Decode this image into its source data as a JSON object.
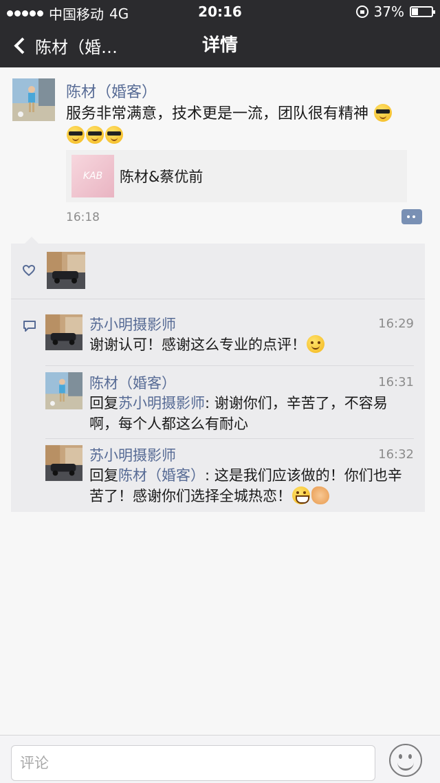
{
  "status_bar": {
    "carrier": "中国移动",
    "network": "4G",
    "time": "20:16",
    "battery": "37%"
  },
  "nav": {
    "back_label": "陈材（婚…",
    "title": "详情"
  },
  "post": {
    "author": "陈材（婚客）",
    "text": "服务非常满意，技术更是一流，团队很有精神",
    "link_card": {
      "title": "陈材&蔡优前",
      "thumb_text": "KAB"
    },
    "time": "16:18"
  },
  "comments": [
    {
      "author": "苏小明摄影师",
      "time": "16:29",
      "text": "谢谢认可！感谢这么专业的点评！"
    },
    {
      "author": "陈材（婚客）",
      "time": "16:31",
      "reply_prefix": "回复",
      "reply_to": "苏小明摄影师",
      "reply_colon": ":",
      "text": "谢谢你们，辛苦了，不容易啊，每个人都这么有耐心"
    },
    {
      "author": "苏小明摄影师",
      "time": "16:32",
      "reply_prefix": "回复",
      "reply_to": "陈材（婚客）",
      "reply_colon": ":",
      "text": "这是我们应该做的！你们也辛苦了！感谢你们选择全城热恋！"
    }
  ],
  "input": {
    "placeholder": "评论"
  },
  "colors": {
    "bar_bg": "#2b2b2e",
    "link_blue": "#576b95",
    "page_bg": "#f7f7f7"
  },
  "icons": [
    "chevron-left-icon",
    "heart-icon",
    "comment-icon",
    "emoji-icon",
    "lock-icon",
    "battery-icon"
  ]
}
